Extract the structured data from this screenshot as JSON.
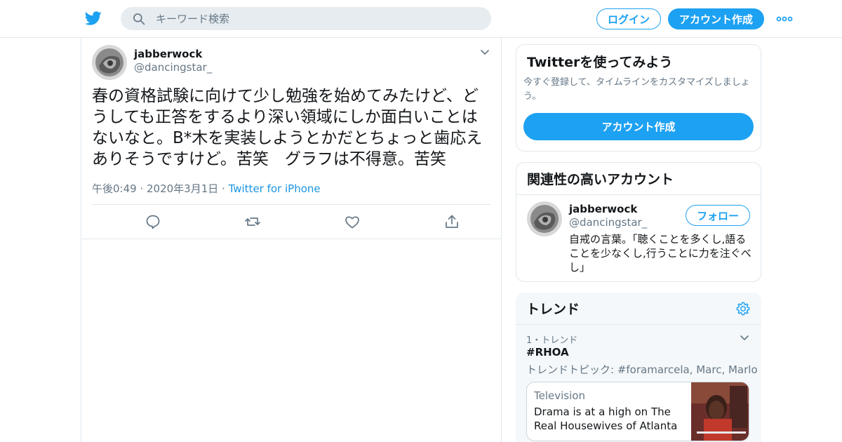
{
  "colors": {
    "brand": "#1da1f2",
    "link": "#1b95e0",
    "secondary_text": "#657786",
    "border": "#e1e8ed"
  },
  "header": {
    "logo_icon": "twitter-bird-icon",
    "search": {
      "placeholder": "キーワード検索",
      "value": ""
    },
    "login_label": "ログイン",
    "signup_label": "アカウント作成",
    "more_icon": "more-dots-icon"
  },
  "tweet": {
    "author_name": "jabberwock",
    "author_handle": "@dancingstar_",
    "text": "春の資格試験に向けて少し勉強を始めてみたけど、どうしても正答をするより深い領域にしか面白いことはないなと。B*木を実装しようとかだとちょっと歯応えありそうですけど。苦笑　グラフは不得意。苦笑",
    "time": "午後0:49 · 2020年3月1日",
    "separator": " · ",
    "source": "Twitter for iPhone",
    "actions": [
      "reply-icon",
      "retweet-icon",
      "like-icon",
      "share-icon"
    ]
  },
  "join_card": {
    "title": "Twitterを使ってみよう",
    "description": "今すぐ登録して、タイムラインをカスタマイズしましょう。",
    "button_label": "アカウント作成"
  },
  "related_card": {
    "title": "関連性の高いアカウント",
    "account": {
      "name": "jabberwock",
      "handle": "@dancingstar_",
      "follow_label": "フォロー",
      "bio": "自戒の言葉。「聴くことを多くし,語ることを少なくし,行うことに力を注ぐべし」"
    }
  },
  "trends_card": {
    "title": "トレンド",
    "items": [
      {
        "rank": "1・トレンド",
        "tag": "#RHOA",
        "topics": "トレンドトピック: #foramarcela, Marc, Marlo",
        "story": {
          "category": "Television",
          "headline": "Drama is at a high on The Real Housewives of Atlanta"
        }
      }
    ]
  }
}
